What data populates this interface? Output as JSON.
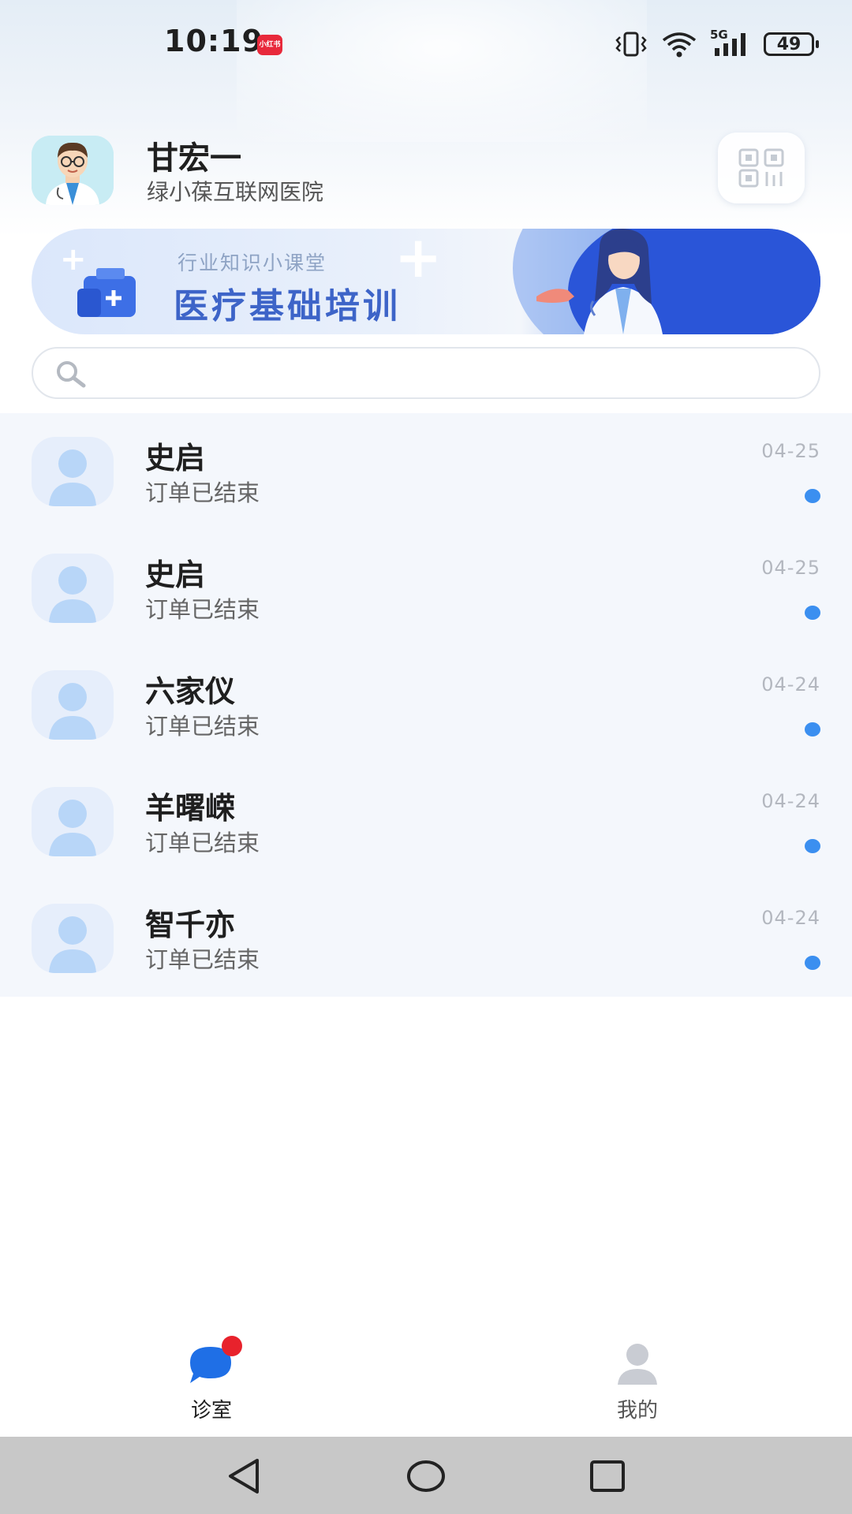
{
  "status_bar": {
    "time": "10:19",
    "app_badge": "小红书",
    "network": "5G",
    "battery": "49"
  },
  "profile": {
    "name": "甘宏一",
    "hospital": "绿小葆互联网医院"
  },
  "banner": {
    "subtitle": "行业知识小课堂",
    "title": "医疗基础培训"
  },
  "search": {
    "placeholder": ""
  },
  "conversations": [
    {
      "name": "史启",
      "status": "订单已结束",
      "date": "04-25"
    },
    {
      "name": "史启",
      "status": "订单已结束",
      "date": "04-25"
    },
    {
      "name": "六家仪",
      "status": "订单已结束",
      "date": "04-24"
    },
    {
      "name": "羊曙嵘",
      "status": "订单已结束",
      "date": "04-24"
    },
    {
      "name": "智千亦",
      "status": "订单已结束",
      "date": "04-24"
    }
  ],
  "tabs": [
    {
      "label": "诊室",
      "icon": "chat-bubble-icon",
      "active": true
    },
    {
      "label": "我的",
      "icon": "person-icon",
      "active": false
    }
  ],
  "colors": {
    "accent": "#3b8ff0",
    "badge": "#e8222c",
    "list_bg": "#f4f7fc"
  }
}
